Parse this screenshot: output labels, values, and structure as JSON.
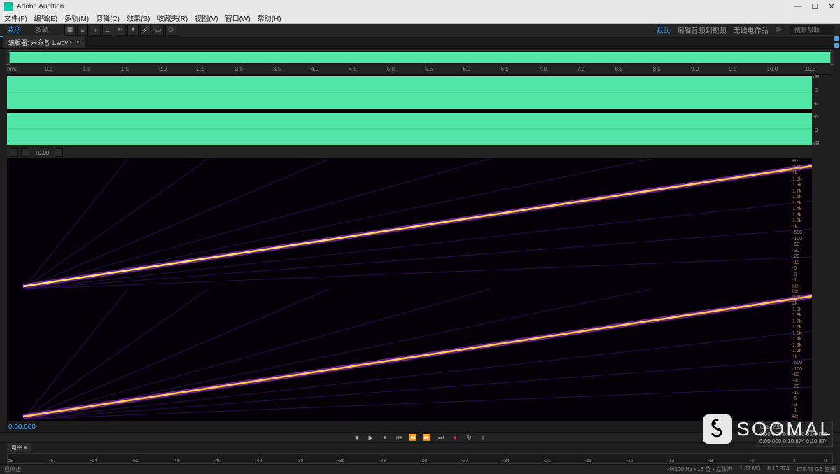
{
  "titlebar": {
    "app": "Adobe Audition"
  },
  "menu": [
    "文件(F)",
    "编辑(E)",
    "多轨(M)",
    "剪辑(C)",
    "效果(S)",
    "收藏夹(R)",
    "视图(V)",
    "窗口(W)",
    "帮助(H)"
  ],
  "modes": {
    "waveform": "波形",
    "multitrack": "多轨"
  },
  "workspaces": {
    "default": "默认",
    "edit": "编辑音频到视频",
    "radio": "无线电作品",
    "search": "搜索帮助"
  },
  "tab": {
    "name": "编辑器: 未命名 1.wav *",
    "close": "×"
  },
  "spectral_toolbar": {
    "value": "+0.00"
  },
  "timecode": "0:00.000",
  "timeline_ticks": [
    "hms",
    "0.5",
    "1.0",
    "1.5",
    "2.0",
    "2.5",
    "3.0",
    "3.5",
    "4.0",
    "4.5",
    "5.0",
    "5.5",
    "6.0",
    "6.5",
    "7.0",
    "7.5",
    "8.0",
    "8.5",
    "9.0",
    "9.5",
    "10.0",
    "10.5"
  ],
  "db_labels": [
    "dB",
    "-3",
    "-6",
    "-6",
    "-3",
    "dB"
  ],
  "hz_labels": [
    "Hz",
    "2.1k",
    "2k",
    "1.9k",
    "1.8k",
    "1.7k",
    "1.6k",
    "1.5k",
    "1.4k",
    "1.3k",
    "1.2k",
    "1k",
    "-500",
    "-100",
    "-60",
    "-30",
    "-20",
    "-10",
    "-5",
    "-3",
    "-1",
    "Hz"
  ],
  "level_ticks": [
    "dB",
    "-57",
    "-54",
    "-51",
    "-48",
    "-45",
    "-42",
    "-39",
    "-36",
    "-33",
    "-30",
    "-27",
    "-24",
    "-21",
    "-18",
    "-15",
    "-12",
    "-9",
    "-6",
    "-3",
    "0"
  ],
  "status": {
    "left": "已停止",
    "sample": "44100 Hz • 16 位 • 立体声",
    "size": "1.81 MB",
    "dur": "0:10.874",
    "free": "175.45 GB 空闲"
  },
  "selection": {
    "label": "选区/视图",
    "start": "0:00.000",
    "end": "0:00.000",
    "view_end": "0:10.874",
    "dur1": "0:00.000",
    "dur2": "0:10.874"
  },
  "watermark": "SOOMAL"
}
